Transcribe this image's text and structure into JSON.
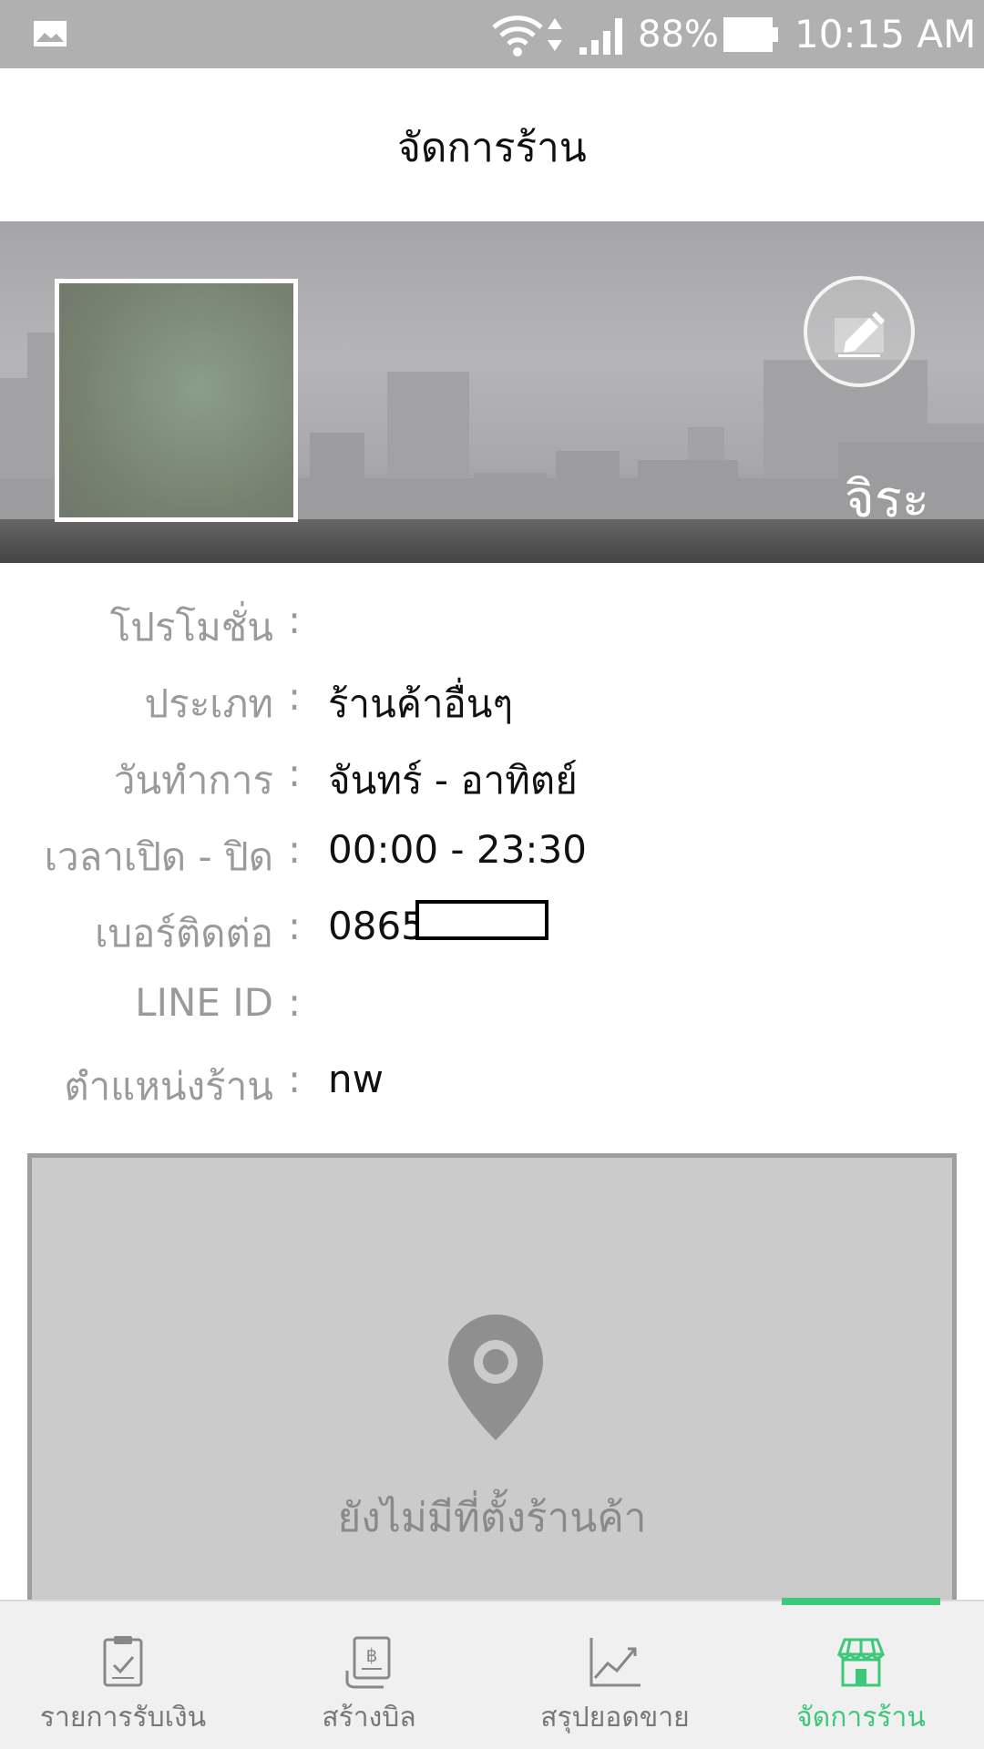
{
  "status_bar": {
    "battery_percent": "88%",
    "time": "10:15 AM"
  },
  "header": {
    "title": "จัดการร้าน"
  },
  "shop": {
    "name": "จิระ"
  },
  "info": {
    "promotion": {
      "label": "โปรโมชั่น",
      "value": ""
    },
    "category": {
      "label": "ประเภท",
      "value": "ร้านค้าอื่นๆ"
    },
    "work_days": {
      "label": "วันทำการ",
      "value": "จันทร์ - อาทิตย์"
    },
    "hours": {
      "label": "เวลาเปิด - ปิด",
      "value": "00:00 - 23:30"
    },
    "phone": {
      "label": "เบอร์ติดต่อ",
      "value": "0865"
    },
    "line_id": {
      "label": "LINE ID",
      "value": ""
    },
    "location": {
      "label": "ตำแหน่งร้าน",
      "value": "nw"
    },
    "colon": ":"
  },
  "map": {
    "empty_text": "ยังไม่มีที่ตั้งร้านค้า"
  },
  "bottom_nav": {
    "items": [
      {
        "label": "รายการรับเงิน",
        "icon": "clipboard-check-icon"
      },
      {
        "label": "สร้างบิล",
        "icon": "baht-receipt-icon"
      },
      {
        "label": "สรุปยอดขาย",
        "icon": "line-chart-icon"
      },
      {
        "label": "จัดการร้าน",
        "icon": "store-icon",
        "active": true
      }
    ]
  },
  "colors": {
    "accent": "#3ec87a",
    "status_bar": "#b0b0b0",
    "label_gray": "#9a9a9a"
  }
}
